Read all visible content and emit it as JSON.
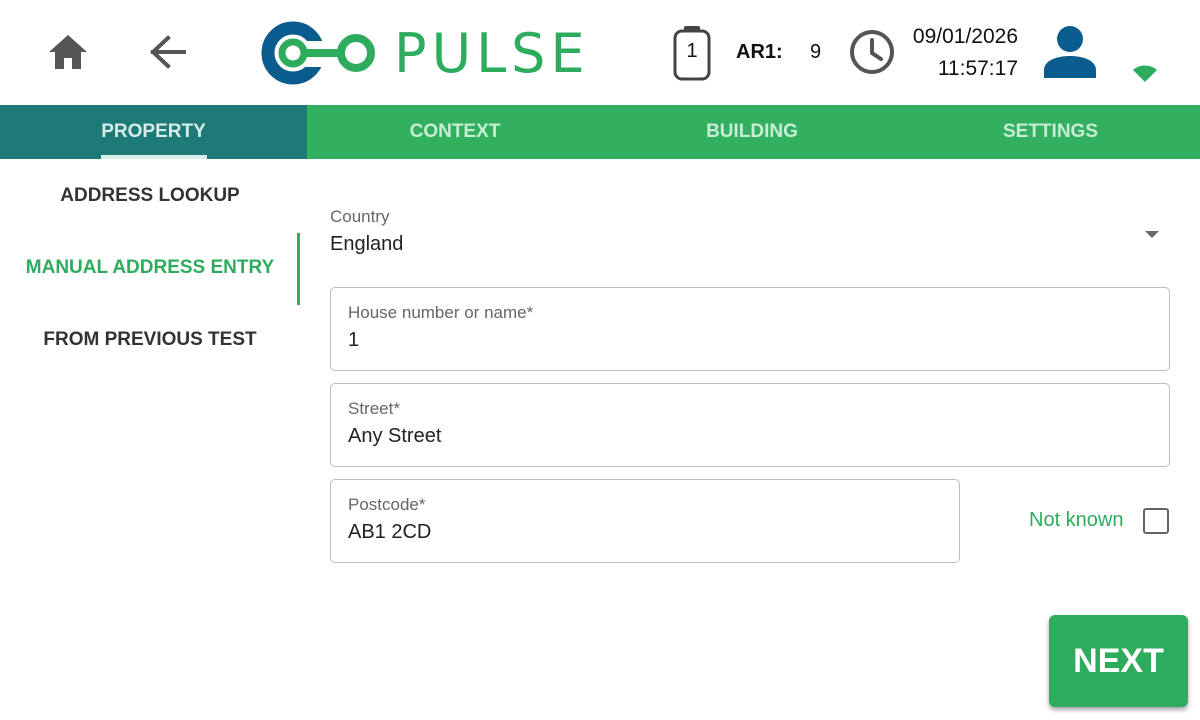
{
  "header": {
    "logo_text": "PULSE",
    "battery_count": "1",
    "ar_label": "AR1:",
    "ar_value": "9",
    "date": "09/01/2026",
    "time": "11:57:17",
    "icons": [
      "home-icon",
      "back-arrow-icon",
      "pulse-logo",
      "battery-icon",
      "clock-icon",
      "user-icon",
      "wifi-icon"
    ]
  },
  "tabs": [
    {
      "label": "PROPERTY",
      "active": true
    },
    {
      "label": "CONTEXT",
      "active": false
    },
    {
      "label": "BUILDING",
      "active": false
    },
    {
      "label": "SETTINGS",
      "active": false
    }
  ],
  "sidebar": {
    "items": [
      {
        "label": "ADDRESS LOOKUP",
        "active": false
      },
      {
        "label": "MANUAL ADDRESS ENTRY",
        "active": true
      },
      {
        "label": "FROM PREVIOUS TEST",
        "active": false
      }
    ]
  },
  "form": {
    "country": {
      "label": "Country",
      "value": "England"
    },
    "house": {
      "label": "House number or name*",
      "value": "1"
    },
    "street": {
      "label": "Street*",
      "value": "Any Street"
    },
    "postcode": {
      "label": "Postcode*",
      "value": "AB1 2CD"
    },
    "not_known_label": "Not known",
    "not_known_checked": false
  },
  "actions": {
    "next_label": "NEXT"
  },
  "colors": {
    "accent_green": "#2eac5e",
    "tab_bar": "#33b05f",
    "active_tab": "#1e7a77",
    "logo_blue": "#0b5c8e"
  }
}
